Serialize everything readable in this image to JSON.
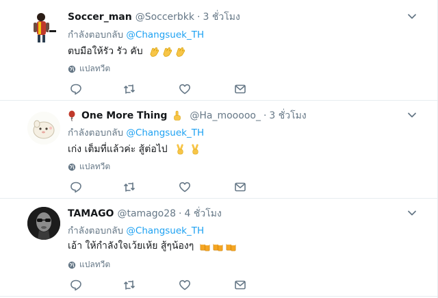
{
  "tweets": [
    {
      "name": "Soccer_man",
      "handle": "@Soccerbkk",
      "dot": "·",
      "time": "3 ชั่วโมง",
      "time_label": "3 ชั่วโมง",
      "reply_prefix": "กำลังตอบกลับ",
      "reply_mention": "@Changsuek_TH",
      "text": "ตบมือให้รัว รัว คับ",
      "translate": "แปลทวีต",
      "emoji": "clapping-hands-icon",
      "emoji_count": 3
    },
    {
      "name_prefix_icon": "balloon-icon",
      "name": "One More Thing",
      "name_suffix_icon": "pointing-up-icon",
      "handle": "@Ha_mooooo_",
      "dot": "·",
      "time": "3 ชั่วโมง",
      "reply_prefix": "กำลังตอบกลับ",
      "reply_mention": "@Changsuek_TH",
      "text": "เก่ง เต็มที่แล้วค่ะ สู้ต่อไป",
      "translate": "แปลทวีต",
      "emoji": "victory-hand-icon",
      "emoji_count": 2
    },
    {
      "name": "TAMAGO",
      "handle": "@tamago28",
      "dot": "·",
      "time": "4 ชั่วโมง",
      "reply_prefix": "กำลังตอบกลับ",
      "reply_mention": "@Changsuek_TH",
      "text": "เอ้า ให้กำลังใจเว้ยเห้ย สู้ๆน้องๆ",
      "translate": "แปลทวีต",
      "emoji": "beer-mugs-icon",
      "emoji_count": 3
    }
  ],
  "colors": {
    "link": "#1da1f2",
    "secondary": "#657786",
    "text": "#14171a",
    "border": "#e6ecf0",
    "emoji_yellow": "#f7c548"
  }
}
